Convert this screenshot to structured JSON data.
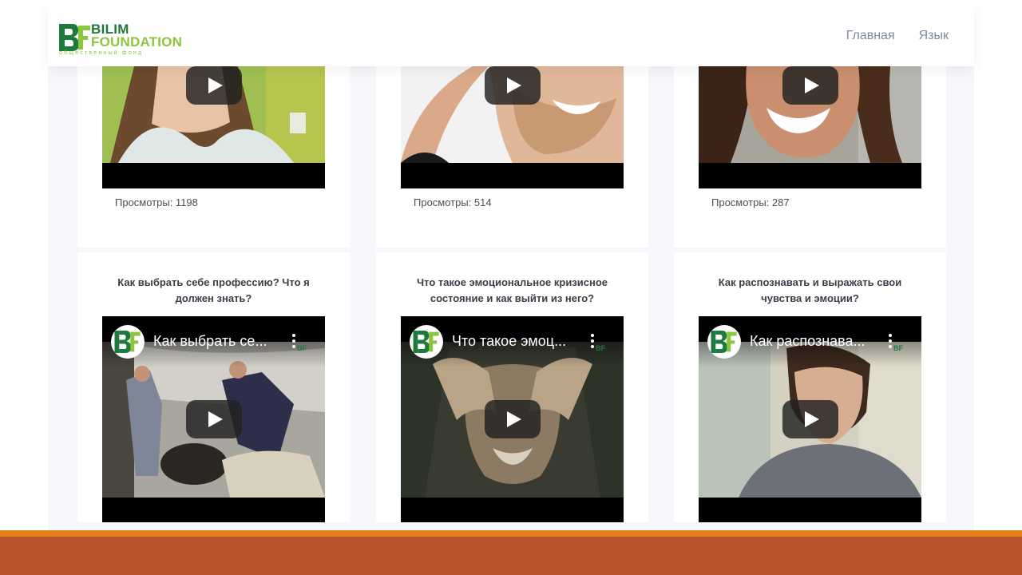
{
  "header": {
    "logo": {
      "line1": "BILIM",
      "line2": "FOUNDATION",
      "tagline": "общественный фонд"
    },
    "nav": [
      {
        "label": "Главная"
      },
      {
        "label": "Язык"
      }
    ]
  },
  "top_cards": [
    {
      "views_label": "Просмотры: 1198"
    },
    {
      "views_label": "Просмотры: 514"
    },
    {
      "views_label": "Просмотры: 287"
    }
  ],
  "bottom_cards": [
    {
      "title": "Как выбрать себе профессию? Что я должен знать?",
      "video_title": "Как выбрать се..."
    },
    {
      "title": "Что такое эмоциональное кризисное состояние и как выйти из него?",
      "video_title": "Что такое эмоц..."
    },
    {
      "title": "Как распознавать и выражать свои чувства и эмоции?",
      "video_title": "Как распознава..."
    }
  ],
  "colors": {
    "brand_dark_green": "#1e7a3c",
    "brand_light_green": "#8cc63f",
    "nav_text": "#7d8a99",
    "footer_orange": "#e1801b",
    "footer_rust": "#b9522a"
  }
}
